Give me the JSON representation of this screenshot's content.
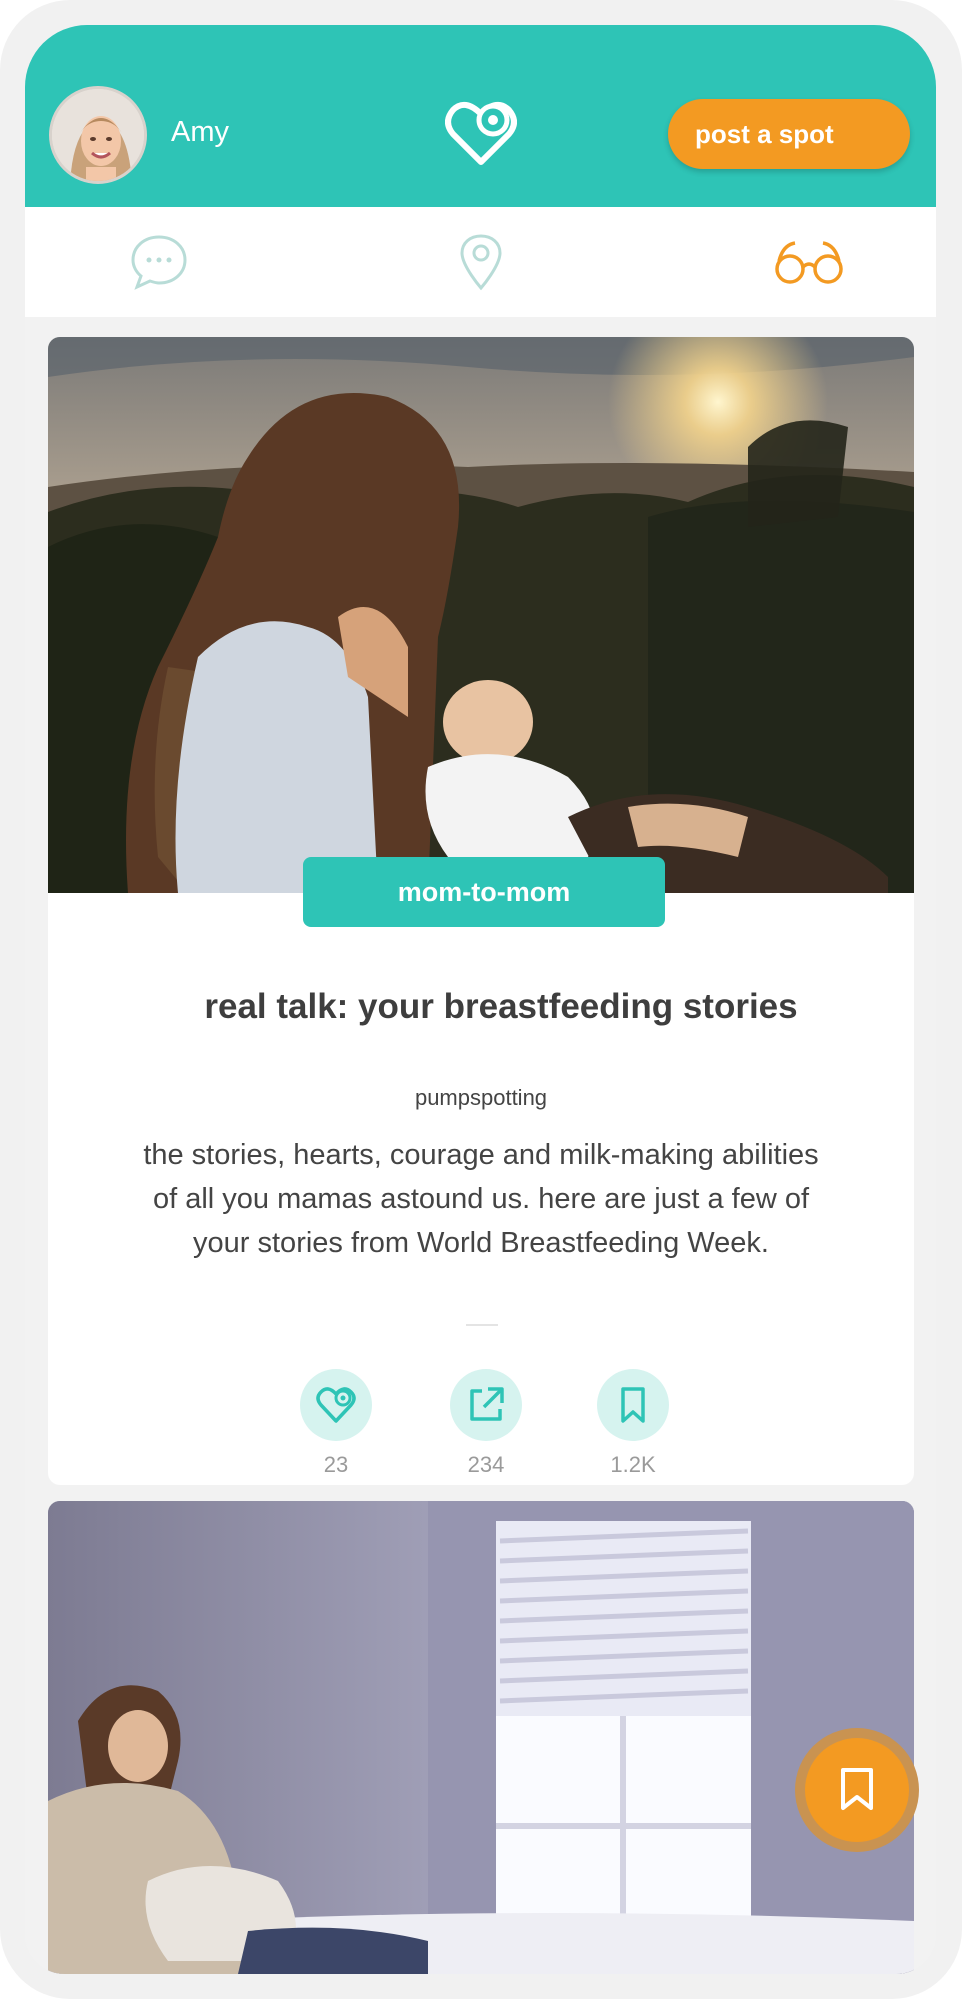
{
  "header": {
    "user_name": "Amy",
    "post_button_label": "post a spot",
    "logo_icon": "heart-pin-icon"
  },
  "tabs": [
    {
      "name": "chat",
      "icon": "chat-bubble-icon",
      "active": false
    },
    {
      "name": "map",
      "icon": "location-pin-icon",
      "active": false
    },
    {
      "name": "read",
      "icon": "glasses-icon",
      "active": true
    }
  ],
  "feed": {
    "cards": [
      {
        "tag": "mom-to-mom",
        "title": "real talk: your breastfeeding stories",
        "author": "pumpspotting",
        "description": "the stories, hearts, courage and milk-making abilities of all you mamas astound us. here are just a few of your stories from World Breastfeeding Week.",
        "actions": [
          {
            "icon": "heart-pin-icon",
            "count": "23"
          },
          {
            "icon": "share-icon",
            "count": "234"
          },
          {
            "icon": "bookmark-icon",
            "count": "1.2K"
          }
        ]
      }
    ]
  },
  "fab": {
    "icon": "bookmark-icon"
  },
  "colors": {
    "teal": "#2ec4b6",
    "orange": "#f39a22",
    "light_teal": "#d6f3ef"
  }
}
